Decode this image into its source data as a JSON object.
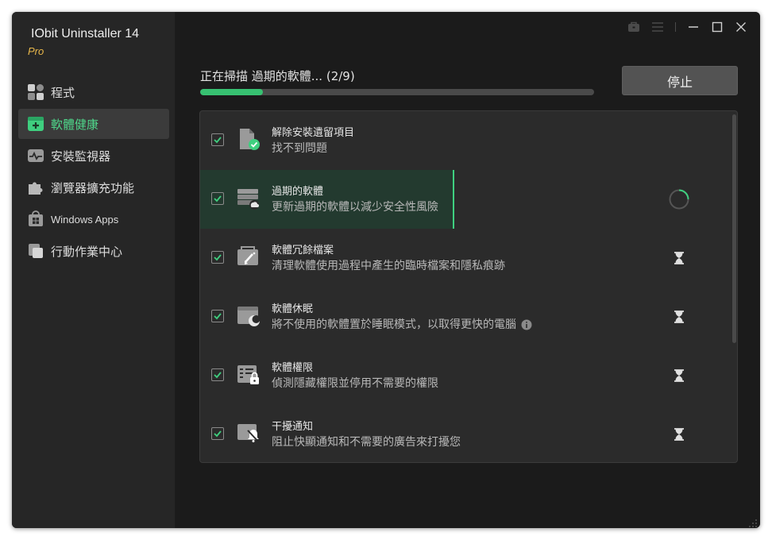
{
  "app": {
    "title": "IObit Uninstaller 14",
    "edition": "Pro"
  },
  "sidebar": {
    "items": [
      {
        "label": "程式",
        "icon": "grid-icon",
        "active": false
      },
      {
        "label": "軟體健康",
        "icon": "health-icon",
        "active": true
      },
      {
        "label": "安裝監視器",
        "icon": "monitor-icon",
        "active": false
      },
      {
        "label": "瀏覽器擴充功能",
        "icon": "puzzle-icon",
        "active": false
      },
      {
        "label": "Windows Apps",
        "icon": "store-icon",
        "active": false
      },
      {
        "label": "行動作業中心",
        "icon": "action-center-icon",
        "active": false
      }
    ]
  },
  "window_controls": [
    "toolbox-icon",
    "menu-icon",
    "minimize-icon",
    "maximize-icon",
    "close-icon"
  ],
  "scan": {
    "status": "正在掃描 過期的軟體... (2/9)",
    "progress": 0.16,
    "stop_label": "停止"
  },
  "items": [
    {
      "title": "解除安裝遺留項目",
      "desc": "找不到問題",
      "status": "done",
      "icon": "leftover-icon"
    },
    {
      "title": "過期的軟體",
      "desc": "更新過期的軟體以減少安全性風險",
      "status": "scanning",
      "icon": "outdated-software-icon"
    },
    {
      "title": "軟體冗餘檔案",
      "desc": "清理軟體使用過程中產生的臨時檔案和隱私痕跡",
      "status": "pending",
      "icon": "junk-files-icon"
    },
    {
      "title": "軟體休眠",
      "desc": "將不使用的軟體置於睡眠模式，以取得更快的電腦",
      "status": "pending",
      "icon": "sleep-icon"
    },
    {
      "title": "軟體權限",
      "desc": "偵測隱藏權限並停用不需要的權限",
      "status": "pending",
      "icon": "permission-icon"
    },
    {
      "title": "干擾通知",
      "desc": "阻止快顯通知和不需要的廣告來打擾您",
      "status": "pending",
      "icon": "notification-icon"
    }
  ],
  "colors": {
    "accent": "#37c171",
    "active_nav_text": "#4fd68a",
    "edition": "#e7b64a",
    "background": "#1b1b1b"
  }
}
